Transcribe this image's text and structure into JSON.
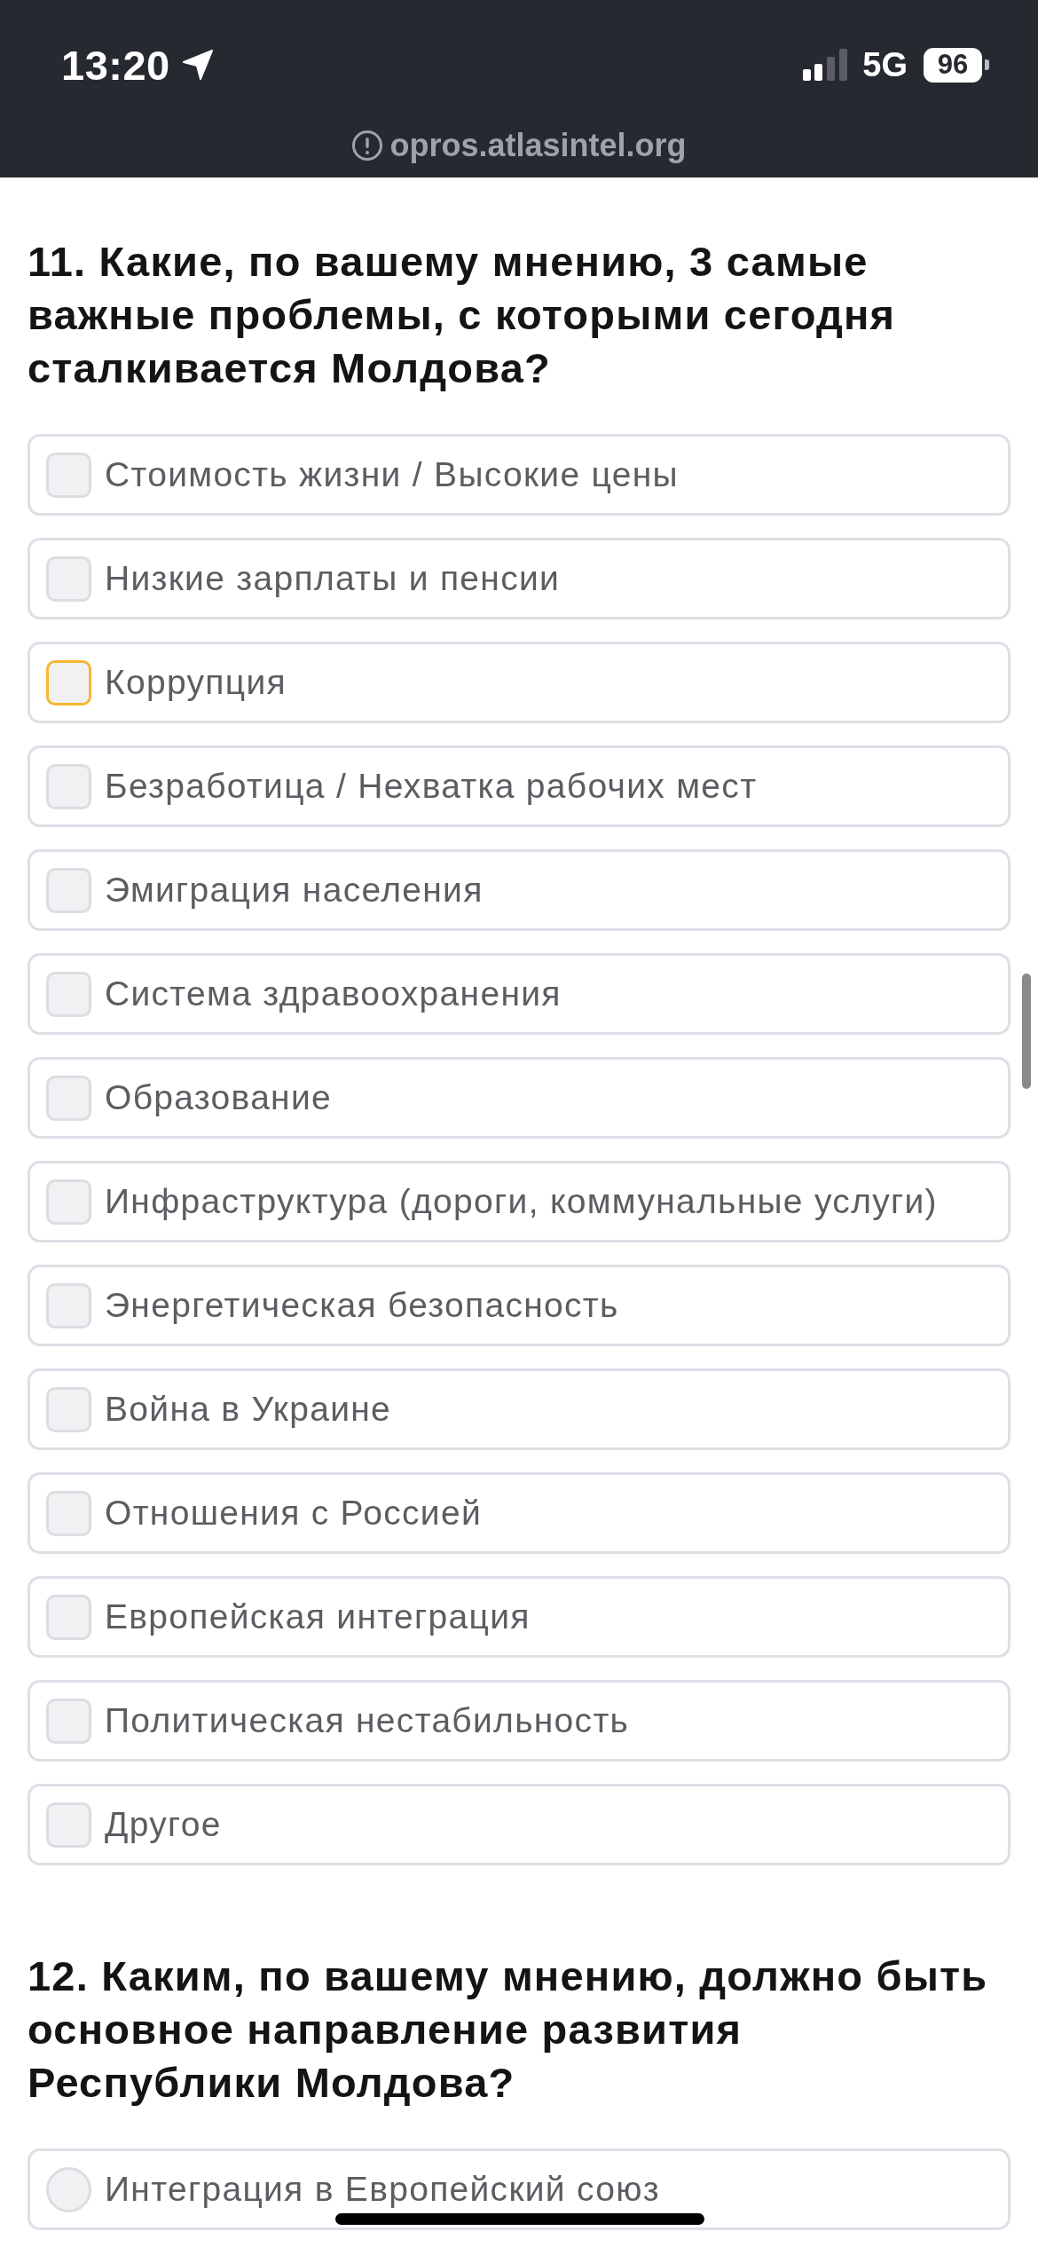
{
  "status_bar": {
    "time": "13:20",
    "network": "5G",
    "battery": "96"
  },
  "address_bar": {
    "url": "opros.atlasintel.org"
  },
  "questions": [
    {
      "title": "11. Какие, по вашему мнению, 3 самые важные проблемы, с которыми сегодня сталкивается Молдова?",
      "kind": "checkbox",
      "options": [
        {
          "label": "Стоимость жизни / Высокие цены",
          "checked": false,
          "focused": false
        },
        {
          "label": "Низкие зарплаты и пенсии",
          "checked": false,
          "focused": false
        },
        {
          "label": "Коррупция",
          "checked": false,
          "focused": true
        },
        {
          "label": "Безработица / Нехватка рабочих мест",
          "checked": false,
          "focused": false
        },
        {
          "label": "Эмиграция населения",
          "checked": false,
          "focused": false
        },
        {
          "label": "Система здравоохранения",
          "checked": false,
          "focused": false
        },
        {
          "label": "Образование",
          "checked": false,
          "focused": false
        },
        {
          "label": "Инфраструктура (дороги, коммунальные услуги)",
          "checked": false,
          "focused": false
        },
        {
          "label": "Энергетическая безопасность",
          "checked": false,
          "focused": false
        },
        {
          "label": "Война в Украине",
          "checked": false,
          "focused": false
        },
        {
          "label": "Отношения с Россией",
          "checked": false,
          "focused": false
        },
        {
          "label": "Европейская интеграция",
          "checked": false,
          "focused": false
        },
        {
          "label": "Политическая нестабильность",
          "checked": false,
          "focused": false
        },
        {
          "label": "Другое",
          "checked": false,
          "focused": false
        }
      ]
    },
    {
      "title": "12. Каким, по вашему мнению, должно быть основное направление развития Республики Молдова?",
      "kind": "radio",
      "options": [
        {
          "label": "Интеграция в Европейский союз",
          "selected": false,
          "focused": false
        }
      ]
    }
  ]
}
